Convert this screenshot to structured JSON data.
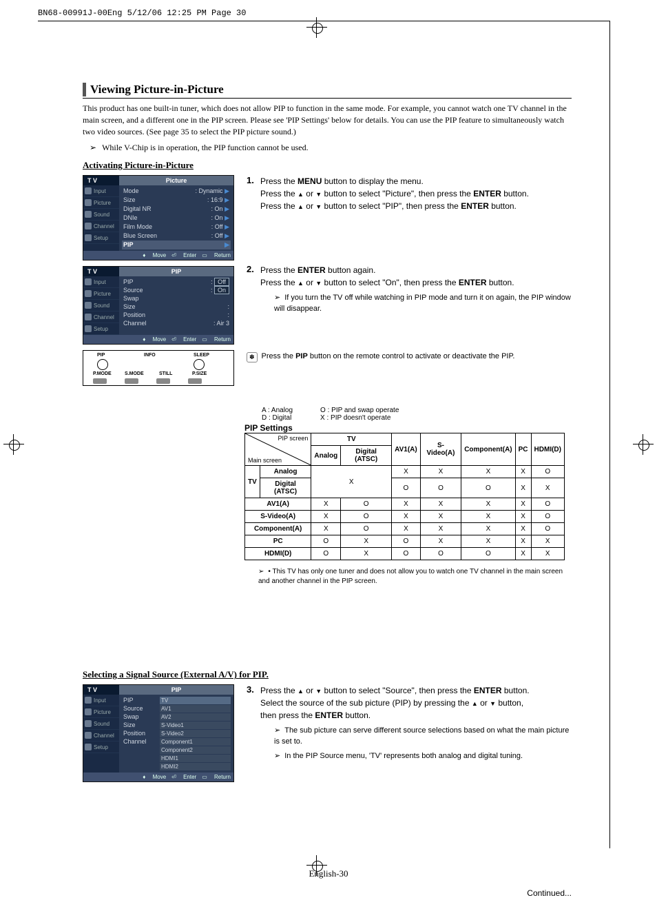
{
  "header_line": "BN68-00991J-00Eng  5/12/06  12:25 PM  Page 30",
  "title": "Viewing Picture-in-Picture",
  "intro": "This product has one built-in tuner, which does not allow PIP to function in the same mode. For example, you cannot watch one TV channel in the main screen, and a different one in the PIP screen. Please see 'PIP Settings' below for details. You can use the PIP feature to simultaneously watch two video sources. (See page 35 to select the PIP picture sound.)",
  "vchip_note": "While V-Chip is in operation, the PIP function cannot be used.",
  "subhead_activate": "Activating Picture-in-Picture",
  "osd1": {
    "tv": "T V",
    "tab": "Picture",
    "side": [
      "Input",
      "Picture",
      "Sound",
      "Channel",
      "Setup"
    ],
    "rows": [
      {
        "k": "Mode",
        "v": ": Dynamic"
      },
      {
        "k": "Size",
        "v": ": 16:9"
      },
      {
        "k": "Digital NR",
        "v": ": On"
      },
      {
        "k": "DNIe",
        "v": ": On"
      },
      {
        "k": "Film Mode",
        "v": ": Off"
      },
      {
        "k": "Blue Screen",
        "v": ": Off"
      },
      {
        "k": "PIP",
        "v": ""
      }
    ],
    "foot": {
      "move": "Move",
      "enter": "Enter",
      "return": "Return"
    }
  },
  "osd2": {
    "tv": "T V",
    "tab": "PIP",
    "side": [
      "Input",
      "Picture",
      "Sound",
      "Channel",
      "Setup"
    ],
    "rows": [
      {
        "k": "PIP",
        "v": "Off"
      },
      {
        "k": "Source",
        "v": "On"
      },
      {
        "k": "Swap",
        "v": ""
      },
      {
        "k": "Size",
        "v": ":"
      },
      {
        "k": "Position",
        "v": ":"
      },
      {
        "k": "Channel",
        "v": ": Air 3"
      }
    ],
    "foot": {
      "move": "Move",
      "enter": "Enter",
      "return": "Return"
    }
  },
  "remote": {
    "labels": [
      "PIP",
      "INFO",
      "SLEEP",
      "P.MODE",
      "S.MODE",
      "STILL",
      "P.SIZE"
    ]
  },
  "steps": {
    "s1": {
      "num": "1.",
      "l1a": "Press the ",
      "l1b": "MENU",
      "l1c": " button to display the menu.",
      "l2a": "Press the ",
      "l2b": " or ",
      "l2c": " button to select \"Picture\", then press the ",
      "l2d": "ENTER",
      "l2e": " button.",
      "l3a": "Press the ",
      "l3b": " or ",
      "l3c": " button to select \"PIP\", then press the ",
      "l3d": "ENTER",
      "l3e": " button."
    },
    "s2": {
      "num": "2.",
      "l1a": "Press the ",
      "l1b": "ENTER",
      "l1c": " button again.",
      "l2a": "Press the ",
      "l2b": " or ",
      "l2c": " button to select \"On\", then press the ",
      "l2d": "ENTER",
      "l2e": " button.",
      "note": "If you turn the TV off while watching in PIP mode and turn it on again, the PIP window will disappear."
    },
    "remote_tip_a": "Press the ",
    "remote_tip_b": "PIP",
    "remote_tip_c": " button on the remote control to activate or deactivate the PIP."
  },
  "legend": {
    "a": "A : Analog",
    "d": "D : Digital",
    "o": "O : PIP and swap operate",
    "x": "X : PIP doesn't operate"
  },
  "pip_table": {
    "title": "PIP Settings",
    "corner_top": "PIP screen",
    "corner_bottom": "Main screen",
    "tv_head": "TV",
    "cols": [
      "Analog",
      "Digital (ATSC)",
      "AV1(A)",
      "S-Video(A)",
      "Component(A)",
      "PC",
      "HDMI(D)"
    ],
    "rows": [
      {
        "head": "TV",
        "sub": "Analog",
        "cells": [
          "X",
          "",
          "X",
          "X",
          "X",
          "X",
          "O"
        ],
        "merge_with_next": true
      },
      {
        "head": "",
        "sub": "Digital (ATSC)",
        "cells": [
          "",
          "",
          "O",
          "O",
          "O",
          "X",
          "X"
        ]
      },
      {
        "head": "AV1(A)",
        "cells": [
          "X",
          "O",
          "X",
          "X",
          "X",
          "X",
          "O"
        ]
      },
      {
        "head": "S-Video(A)",
        "cells": [
          "X",
          "O",
          "X",
          "X",
          "X",
          "X",
          "O"
        ]
      },
      {
        "head": "Component(A)",
        "cells": [
          "X",
          "O",
          "X",
          "X",
          "X",
          "X",
          "O"
        ]
      },
      {
        "head": "PC",
        "cells": [
          "O",
          "X",
          "O",
          "X",
          "X",
          "X",
          "X"
        ]
      },
      {
        "head": "HDMI(D)",
        "cells": [
          "O",
          "X",
          "O",
          "O",
          "O",
          "X",
          "X"
        ]
      }
    ],
    "note": "• This TV has only one tuner and does not allow you to watch one TV channel in the main screen and another channel in the PIP screen."
  },
  "subhead_source": "Selecting a Signal Source (External A/V) for PIP.",
  "osd3": {
    "tv": "T V",
    "tab": "PIP",
    "side": [
      "Input",
      "Picture",
      "Sound",
      "Channel",
      "Setup"
    ],
    "rows": [
      {
        "k": "PIP",
        "v": ""
      },
      {
        "k": "Source",
        "v": ""
      },
      {
        "k": "Swap",
        "v": ""
      },
      {
        "k": "Size",
        "v": ""
      },
      {
        "k": "Position",
        "v": ""
      },
      {
        "k": "Channel",
        "v": ""
      }
    ],
    "sources": [
      "TV",
      "AV1",
      "AV2",
      "S-Video1",
      "S-Video2",
      "Component1",
      "Component2",
      "HDMI1",
      "HDMI2"
    ],
    "foot": {
      "move": "Move",
      "enter": "Enter",
      "return": "Return"
    }
  },
  "step3": {
    "num": "3.",
    "l1a": "Press the ",
    "l1b": " or ",
    "l1c": " button to select \"Source\", then press the ",
    "l1d": "ENTER",
    "l1e": " button.",
    "l2a": "Select the source of the sub picture (PIP) by pressing the ",
    "l2b": " or ",
    "l2c": " button,",
    "l3": "then press the ",
    "l3b": "ENTER",
    "l3c": " button.",
    "n1": "The sub picture can serve different source selections based on what the main picture is set to.",
    "n2": "In the PIP Source menu, 'TV' represents both analog and digital tuning."
  },
  "continued": "Continued...",
  "pagefoot": "English-30"
}
